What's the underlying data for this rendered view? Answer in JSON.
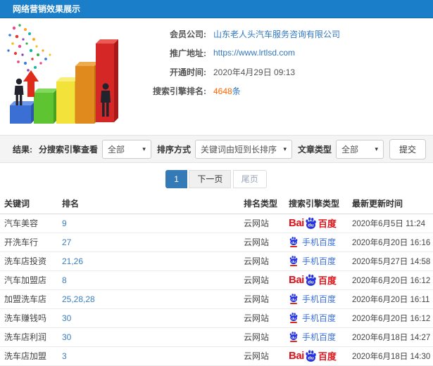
{
  "header": {
    "title": "网络营销效果展示"
  },
  "profile": {
    "fields": [
      {
        "label": "会员公司:",
        "value": "山东老人头汽车服务咨询有限公司",
        "type": "link"
      },
      {
        "label": "推广地址:",
        "value": "https://www.lrtlsd.com",
        "type": "link"
      },
      {
        "label": "开通时间:",
        "value": "2020年4月29日 09:13",
        "type": "text"
      },
      {
        "label": "搜索引擎排名:",
        "value": "4648",
        "suffix": "条",
        "type": "highlight"
      }
    ]
  },
  "filters": {
    "result_label": "结果:",
    "engine_label": "分搜索引擎查看",
    "engine_value": "全部",
    "sort_label": "排序方式",
    "sort_value": "关键词由短到长排序",
    "type_label": "文章类型",
    "type_value": "全部",
    "submit_label": "提交"
  },
  "pagination": {
    "current": "1",
    "next": "下一页",
    "last": "尾页"
  },
  "table": {
    "headers": [
      "关键词",
      "排名",
      "排名类型",
      "搜索引擎类型",
      "最新更新时间"
    ],
    "rows": [
      {
        "keyword": "汽车美容",
        "rank": "9",
        "rank_type": "云网站",
        "engine": "baidu",
        "time": "2020年6月5日 11:24"
      },
      {
        "keyword": "开洗车行",
        "rank": "27",
        "rank_type": "云网站",
        "engine": "mobile-baidu",
        "time": "2020年6月20日 16:16"
      },
      {
        "keyword": "洗车店投资",
        "rank": "21,26",
        "rank_type": "云网站",
        "engine": "mobile-baidu",
        "time": "2020年5月27日 14:58"
      },
      {
        "keyword": "汽车加盟店",
        "rank": "8",
        "rank_type": "云网站",
        "engine": "baidu",
        "time": "2020年6月20日 16:12"
      },
      {
        "keyword": "加盟洗车店",
        "rank": "25,28,28",
        "rank_type": "云网站",
        "engine": "mobile-baidu",
        "time": "2020年6月20日 16:11"
      },
      {
        "keyword": "洗车赚钱吗",
        "rank": "30",
        "rank_type": "云网站",
        "engine": "mobile-baidu",
        "time": "2020年6月20日 16:12"
      },
      {
        "keyword": "洗车店利润",
        "rank": "30",
        "rank_type": "云网站",
        "engine": "mobile-baidu",
        "time": "2020年6月18日 14:27"
      },
      {
        "keyword": "洗车店加盟",
        "rank": "3",
        "rank_type": "云网站",
        "engine": "baidu",
        "time": "2020年6月18日 14:30"
      }
    ],
    "baidu_logo": {
      "prefix": "Bai",
      "paw_text": "du",
      "suffix": "百度"
    },
    "mobile_baidu_label": "手机百度"
  },
  "colors": {
    "header_blue": "#1a7ec8",
    "link_blue": "#3178be",
    "highlight_orange": "#ff6600",
    "baidu_red": "#de1219",
    "baidu_paw_blue": "#2534de",
    "mobile_text_blue": "#3a6fd8",
    "active_page_blue": "#337ab7"
  }
}
